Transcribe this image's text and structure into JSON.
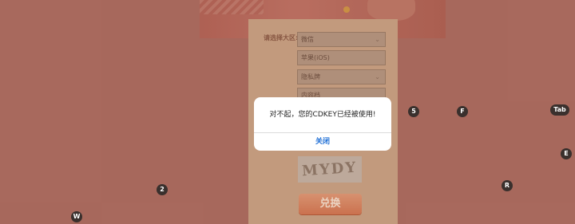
{
  "form": {
    "region_label": "请选择大区:",
    "fields": [
      {
        "value": "微信",
        "chevron": "⌄"
      },
      {
        "value": "苹果(iOS)",
        "chevron": ""
      },
      {
        "value": "隐私牌",
        "chevron": "⌄"
      },
      {
        "value": "内容档",
        "chevron": ""
      }
    ],
    "captcha_text": "MYDY",
    "redeem_label": "兑换"
  },
  "dialog": {
    "message": "对不起，您的CDKEY已经被使用!",
    "close_label": "关闭"
  },
  "key_hints": [
    {
      "label": "5"
    },
    {
      "label": "F"
    },
    {
      "label": "Tab"
    },
    {
      "label": "E"
    },
    {
      "label": "R"
    },
    {
      "label": "2"
    },
    {
      "label": "W"
    }
  ]
}
